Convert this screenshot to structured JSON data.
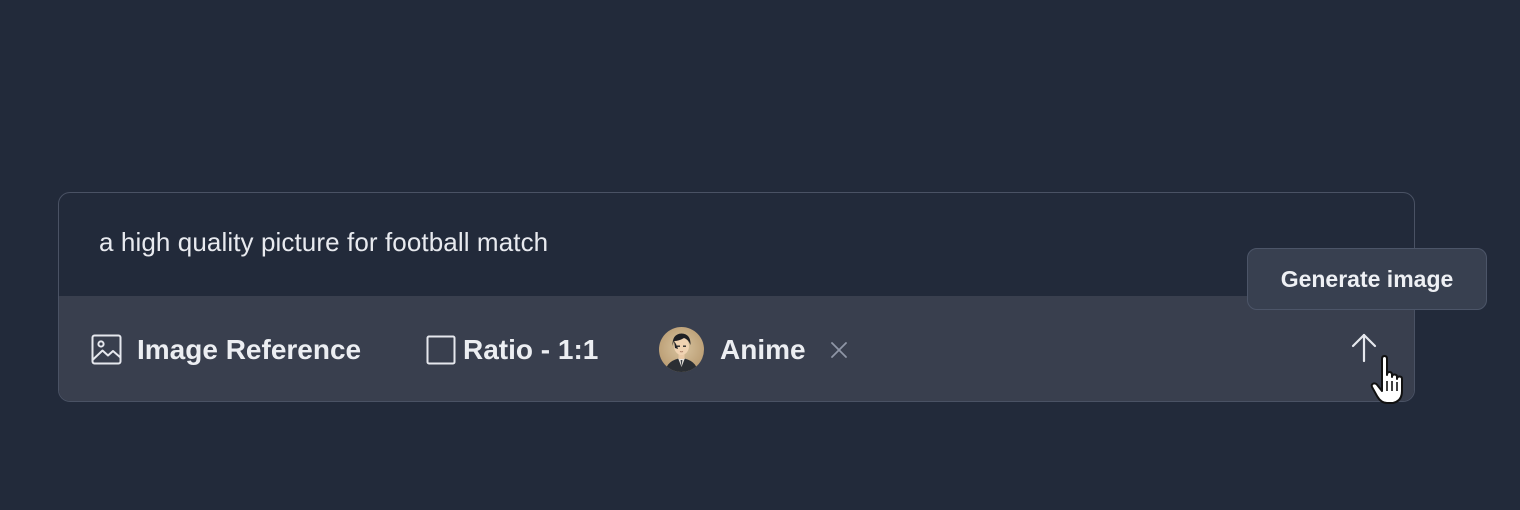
{
  "composer": {
    "prompt_text": "a high quality picture for football match"
  },
  "toolbar": {
    "image_reference_label": "Image Reference",
    "image_reference_icon": "image-icon",
    "ratio_label": "Ratio - 1:1",
    "ratio_icon": "square-icon",
    "style_label": "Anime",
    "style_avatar_icon": "anime-avatar",
    "remove_style_glyph": "×",
    "send_icon": "arrow-up-icon"
  },
  "tooltip": {
    "text": "Generate image"
  },
  "colors": {
    "background": "#222a3a",
    "toolbar": "#393f4e",
    "tooltip": "#384050",
    "text": "#e8eaef",
    "muted": "#8f96a6"
  }
}
